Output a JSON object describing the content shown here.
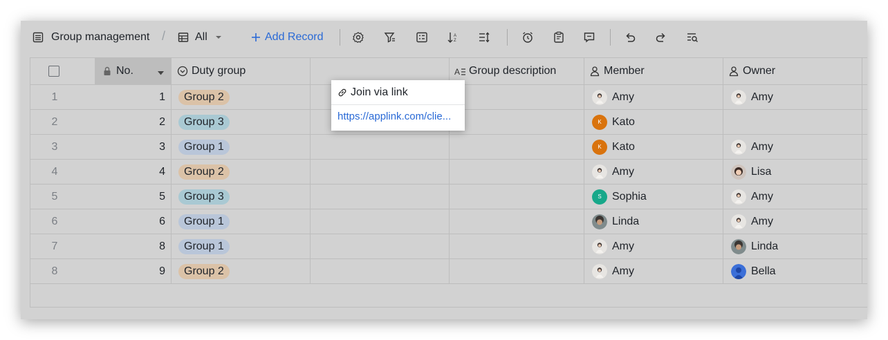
{
  "toolbar": {
    "table_name": "Group management",
    "view_name": "All",
    "add_record_label": "Add Record",
    "icons": [
      "table-icon",
      "grid-view-icon",
      "chevron-down-icon",
      "plus-icon",
      "gear-icon",
      "filter-icon",
      "group-by-icon",
      "sort-icon",
      "row-height-icon",
      "alarm-icon",
      "form-icon",
      "comment-icon",
      "undo-icon",
      "redo-icon",
      "search-icon"
    ]
  },
  "columns": {
    "no": "No.",
    "duty_group": "Duty group",
    "join_link": "Join via link",
    "description": "Group description",
    "member": "Member",
    "owner": "Owner"
  },
  "rows": [
    {
      "index": "1",
      "no": "1",
      "group": "Group 2",
      "member": "Amy",
      "owner": "Amy"
    },
    {
      "index": "2",
      "no": "2",
      "group": "Group 3",
      "member": "Kato",
      "owner": ""
    },
    {
      "index": "3",
      "no": "3",
      "group": "Group 1",
      "member": "Kato",
      "owner": "Amy"
    },
    {
      "index": "4",
      "no": "4",
      "group": "Group 2",
      "member": "Amy",
      "owner": "Lisa"
    },
    {
      "index": "5",
      "no": "5",
      "group": "Group 3",
      "member": "Sophia",
      "owner": "Amy"
    },
    {
      "index": "6",
      "no": "6",
      "group": "Group 1",
      "member": "Linda",
      "owner": "Amy"
    },
    {
      "index": "7",
      "no": "8",
      "group": "Group 1",
      "member": "Amy",
      "owner": "Linda"
    },
    {
      "index": "8",
      "no": "9",
      "group": "Group 2",
      "member": "Amy",
      "owner": "Bella"
    }
  ],
  "popup": {
    "link_text": "https://applink.com/clie..."
  },
  "avatar_initials": {
    "Kato": "K",
    "Sophia": "S"
  },
  "colors": {
    "group_1": "#b9c6d9",
    "group_2": "#dbc2a7",
    "group_3": "#a9c9d3",
    "link": "#2a6ad6",
    "kato": "#d9730d",
    "sophia": "#17a88a"
  }
}
